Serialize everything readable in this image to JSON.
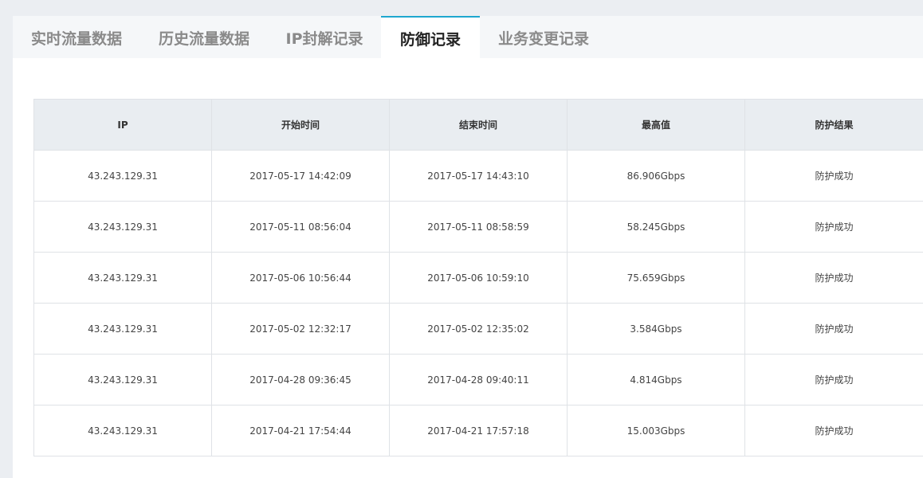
{
  "tabs": [
    {
      "label": "实时流量数据",
      "active": false
    },
    {
      "label": "历史流量数据",
      "active": false
    },
    {
      "label": "IP封解记录",
      "active": false
    },
    {
      "label": "防御记录",
      "active": true
    },
    {
      "label": "业务变更记录",
      "active": false
    }
  ],
  "table": {
    "headers": [
      "IP",
      "开始时间",
      "结束时间",
      "最高值",
      "防护结果"
    ],
    "rows": [
      [
        "43.243.129.31",
        "2017-05-17 14:42:09",
        "2017-05-17 14:43:10",
        "86.906Gbps",
        "防护成功"
      ],
      [
        "43.243.129.31",
        "2017-05-11 08:56:04",
        "2017-05-11 08:58:59",
        "58.245Gbps",
        "防护成功"
      ],
      [
        "43.243.129.31",
        "2017-05-06 10:56:44",
        "2017-05-06 10:59:10",
        "75.659Gbps",
        "防护成功"
      ],
      [
        "43.243.129.31",
        "2017-05-02 12:32:17",
        "2017-05-02 12:35:02",
        "3.584Gbps",
        "防护成功"
      ],
      [
        "43.243.129.31",
        "2017-04-28 09:36:45",
        "2017-04-28 09:40:11",
        "4.814Gbps",
        "防护成功"
      ],
      [
        "43.243.129.31",
        "2017-04-21 17:54:44",
        "2017-04-21 17:57:18",
        "15.003Gbps",
        "防护成功"
      ]
    ]
  },
  "colors": {
    "accent": "#1ea7cf",
    "background": "#ebeef2",
    "header_bg": "#e9edf1",
    "border": "#dfe2e6"
  }
}
